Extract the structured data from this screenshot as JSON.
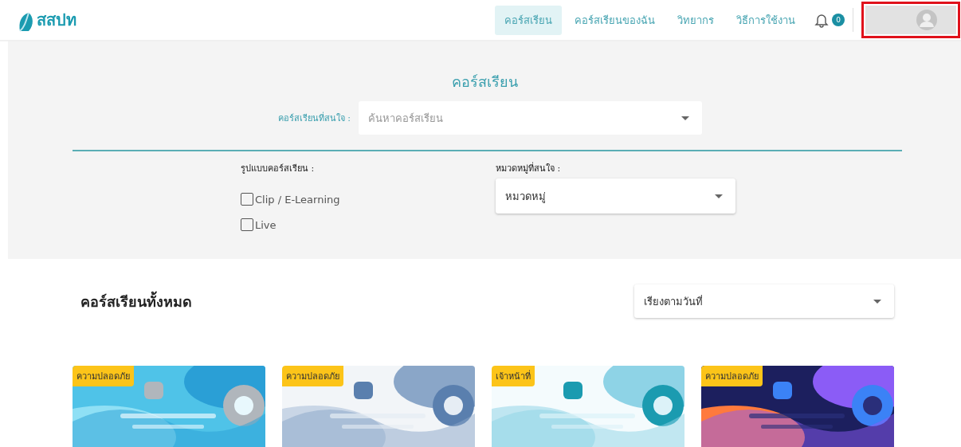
{
  "header": {
    "logo": "สสปท",
    "nav": [
      {
        "label": "คอร์สเรียน",
        "selected": true
      },
      {
        "label": "คอร์สเรียนของฉัน",
        "selected": false
      },
      {
        "label": "วิทยากร",
        "selected": false
      },
      {
        "label": "วิธีการใช้งาน",
        "selected": false
      }
    ],
    "notifications": "0"
  },
  "filters": {
    "title": "คอร์สเรียน",
    "course_label": "คอร์สเรียนที่สนใจ :",
    "course_placeholder": "ค้นหาคอร์สเรียน",
    "format_label": "รูปแบบคอร์สเรียน :",
    "formats": [
      {
        "label": "Clip / E-Learning",
        "checked": false
      },
      {
        "label": "Live",
        "checked": false
      }
    ],
    "category_label": "หมวดหมู่ที่สนใจ :",
    "category_value": "หมวดหมู่"
  },
  "courses": {
    "title": "คอร์สเรียนทั้งหมด",
    "sort": "เรียงตามวันที่",
    "cards": [
      {
        "badge": "ความปลอดภัย"
      },
      {
        "badge": "ความปลอดภัย"
      },
      {
        "badge": "เจ้าหน้าที่"
      },
      {
        "badge": "ความปลอดภัย"
      }
    ]
  }
}
